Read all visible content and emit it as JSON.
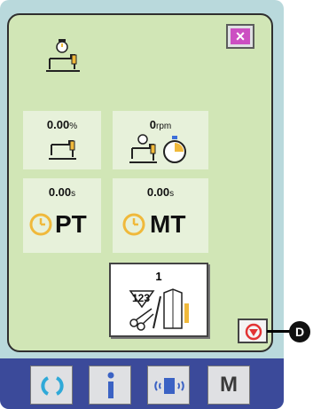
{
  "cells": {
    "speed_ratio": {
      "value": "0.00",
      "unit": "%"
    },
    "rpm": {
      "value": "0",
      "unit": "rpm"
    },
    "pitch_time": {
      "value": "0.00",
      "unit": "s",
      "label": "PT"
    },
    "machine_time": {
      "value": "0.00",
      "unit": "s",
      "label": "MT"
    }
  },
  "counter": {
    "value": "1",
    "glyph": "123"
  },
  "callout": {
    "label": "D"
  },
  "buttons": {
    "close": "×",
    "menu": "M"
  },
  "colors": {
    "panel": "#d1e6b6",
    "frame": "#b9d9dc",
    "clock": "#f0b93b",
    "accent": "#cc4fc2",
    "bar": "#3b4a9a"
  }
}
